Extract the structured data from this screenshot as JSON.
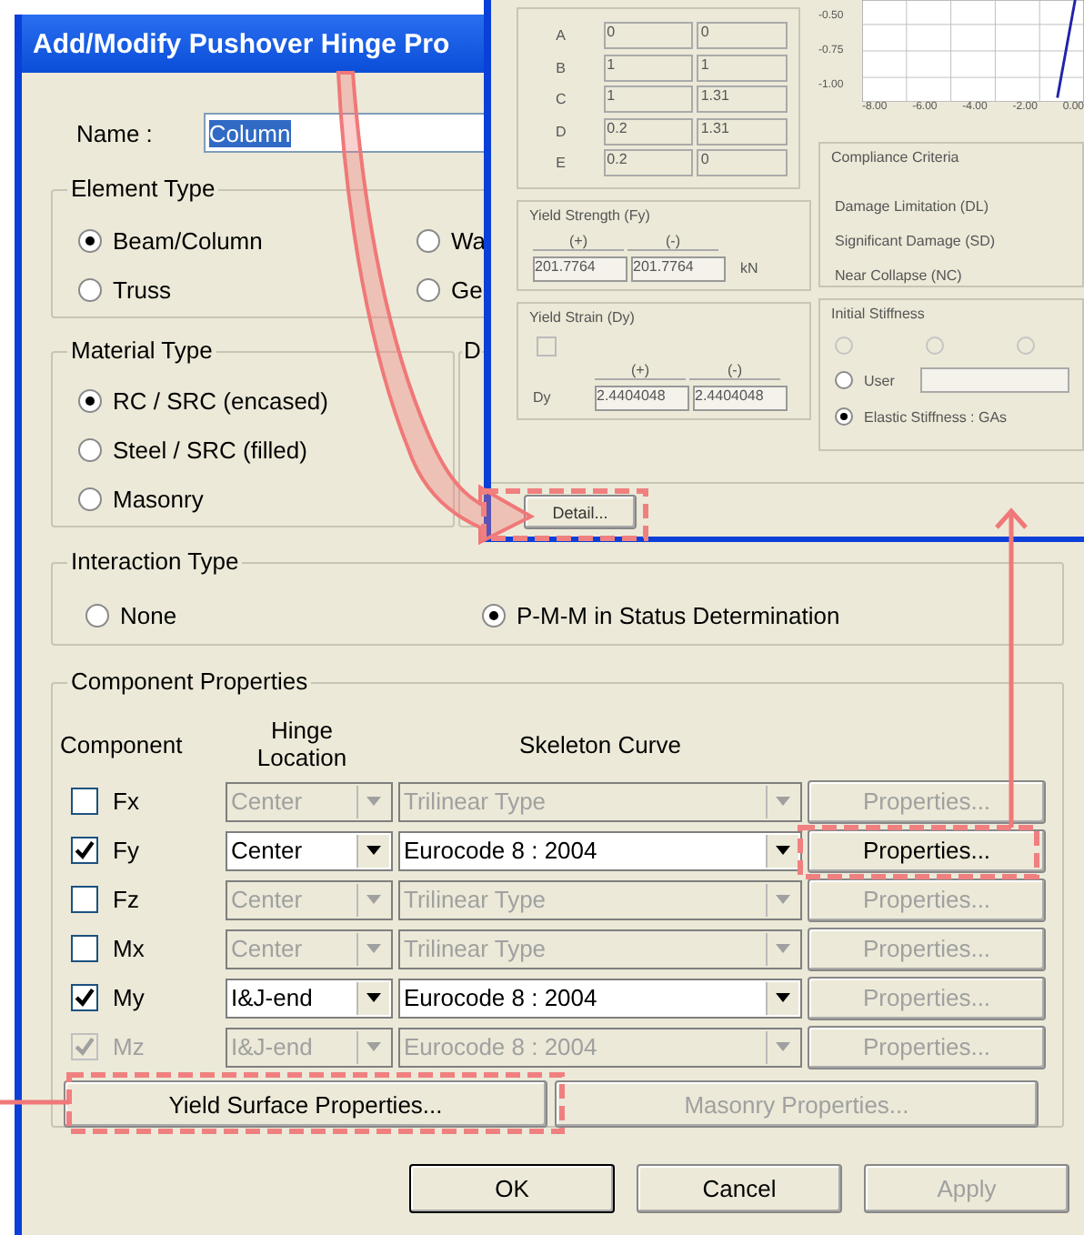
{
  "main_dialog": {
    "title": "Add/Modify Pushover Hinge Pro",
    "name_label": "Name :",
    "name_value": "Column",
    "element_type": {
      "title": "Element Type",
      "options": [
        {
          "label": "Beam/Column",
          "selected": true
        },
        {
          "label": "Wa",
          "selected": false
        },
        {
          "label": "Truss",
          "selected": false
        },
        {
          "label": "Ge",
          "selected": false
        }
      ]
    },
    "material_type": {
      "title": "Material Type",
      "options": [
        {
          "label": "RC / SRC (encased)",
          "selected": true
        },
        {
          "label": "Steel / SRC (filled)",
          "selected": false
        },
        {
          "label": "Masonry",
          "selected": false
        }
      ]
    },
    "partial_group_title": "D",
    "interaction_type": {
      "title": "Interaction Type",
      "options": [
        {
          "label": "None",
          "selected": false
        },
        {
          "label": "P-M-M in Status Determination",
          "selected": true
        }
      ]
    },
    "component_properties": {
      "title": "Component Properties",
      "headers": [
        "Component",
        "Hinge Location",
        "Skeleton Curve"
      ],
      "rows": [
        {
          "component": "Fx",
          "checked": false,
          "checkbox_disabled": false,
          "active": false,
          "location": "Center",
          "curve": "Trilinear Type",
          "properties": "Properties...",
          "properties_disabled": true
        },
        {
          "component": "Fy",
          "checked": true,
          "checkbox_disabled": false,
          "active": true,
          "location": "Center",
          "curve": "Eurocode 8 : 2004",
          "properties": "Properties...",
          "properties_disabled": false
        },
        {
          "component": "Fz",
          "checked": false,
          "checkbox_disabled": false,
          "active": false,
          "location": "Center",
          "curve": "Trilinear Type",
          "properties": "Properties...",
          "properties_disabled": true
        },
        {
          "component": "Mx",
          "checked": false,
          "checkbox_disabled": false,
          "active": false,
          "location": "Center",
          "curve": "Trilinear Type",
          "properties": "Properties...",
          "properties_disabled": true
        },
        {
          "component": "My",
          "checked": true,
          "checkbox_disabled": false,
          "active": true,
          "location": "I&J-end",
          "curve": "Eurocode 8 : 2004",
          "properties": "Properties...",
          "properties_disabled": true
        },
        {
          "component": "Mz",
          "checked": true,
          "checkbox_disabled": true,
          "active": false,
          "location": "I&J-end",
          "curve": "Eurocode 8 : 2004",
          "properties": "Properties...",
          "properties_disabled": true
        }
      ],
      "buttons": [
        {
          "label": "Yield Surface Properties...",
          "disabled": false
        },
        {
          "label": "Masonry Properties...",
          "disabled": true
        }
      ]
    },
    "buttons": [
      {
        "label": "OK",
        "disabled": false,
        "default": true
      },
      {
        "label": "Cancel",
        "disabled": false,
        "default": false
      },
      {
        "label": "Apply",
        "disabled": true,
        "default": false
      }
    ]
  },
  "detail_dialog": {
    "table_rows": [
      {
        "point": "A",
        "value_1": "0",
        "value_2": "0"
      },
      {
        "point": "B",
        "value_1": "1",
        "value_2": "1"
      },
      {
        "point": "C",
        "value_1": "1",
        "value_2": "1.31"
      },
      {
        "point": "D",
        "value_1": "0.2",
        "value_2": "1.31"
      },
      {
        "point": "E",
        "value_1": "0.2",
        "value_2": "0"
      }
    ],
    "chart_y_ticks": [
      "-0.50",
      "-0.75",
      "-1.00"
    ],
    "chart_x_ticks": [
      "-8.00",
      "-6.00",
      "-4.00",
      "-2.00",
      "0.00"
    ],
    "yield_strength": {
      "title": "Yield Strength (Fy)",
      "headers": [
        "(+)",
        "(-)"
      ],
      "values": [
        "201.7764",
        "201.7764"
      ],
      "unit": "kN"
    },
    "yield_strain": {
      "title": "Yield Strain (Dy)",
      "default_checked": false,
      "headers": [
        "(+)",
        "(-)"
      ],
      "label": "Dy",
      "values": [
        "2.4404048",
        "2.4404048"
      ]
    },
    "compliance": {
      "title": "Compliance Criteria",
      "items": [
        "Damage Limitation (DL)",
        "Significant Damage (SD)",
        "Near Collapse (NC)"
      ]
    },
    "initial_stiffness": {
      "title": "Initial Stiffness",
      "options": [
        {
          "kind": "blank",
          "selected": false,
          "disabled": true
        },
        {
          "kind": "blank",
          "selected": false,
          "disabled": true
        },
        {
          "kind": "blank",
          "selected": false,
          "disabled": true
        },
        {
          "kind": "field",
          "label": "User",
          "selected": false,
          "disabled": false
        },
        {
          "kind": "plain",
          "label": "Elastic Stiffness : GAs",
          "selected": true,
          "disabled": false
        }
      ]
    },
    "detail_button": "Detail..."
  }
}
